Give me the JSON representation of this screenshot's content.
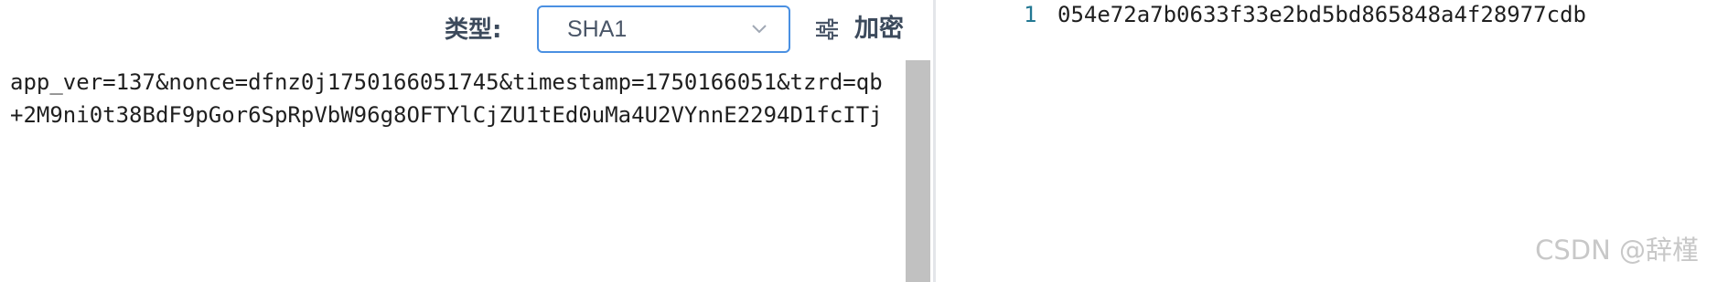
{
  "toolbar": {
    "type_label": "类型:",
    "select": {
      "selected": "SHA1"
    },
    "settings_icon": "sliders-icon",
    "encrypt_label": "加密"
  },
  "input": {
    "lines": [
      "app_ver=137&nonce=dfnz0j1750166051745&timestamp=1750166051&tzrd=qb",
      "+2M9ni0t38BdF9pGor6SpRpVbW96g8OFTYlCjZU1tEd0uMa4U2VYnnE2294D1fcITj"
    ]
  },
  "output": {
    "line_number": "1",
    "value": "054e72a7b0633f33e2bd5bd865848a4f28977cdb"
  },
  "watermark": "CSDN @辞槿",
  "colors": {
    "select_border": "#4a90e2",
    "label_text": "#3c4a5c",
    "line_number": "#237893",
    "scrollbar_thumb": "#c1c1c1"
  }
}
